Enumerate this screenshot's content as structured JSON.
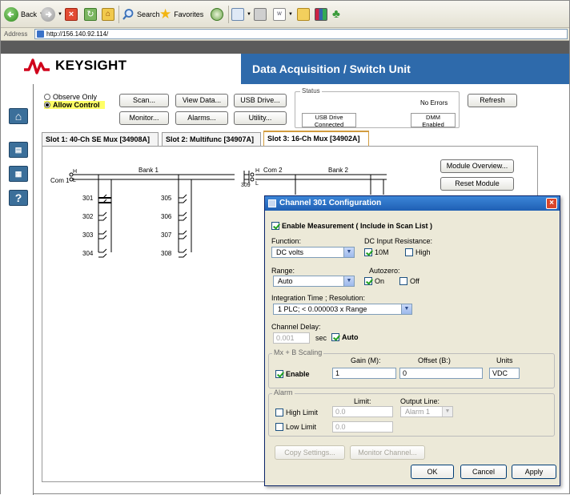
{
  "browser": {
    "toolbar": {
      "back_label": "Back",
      "search_label": "Search",
      "favorites_label": "Favorites"
    },
    "address": {
      "label": "Address",
      "url": "http://156.140.92.114/"
    }
  },
  "header": {
    "logo_text": "KEYSIGHT",
    "title": "Data Acquisition / Switch Unit"
  },
  "controls": {
    "observe_only": "Observe Only",
    "allow_control": "Allow Control",
    "buttons": {
      "scan": "Scan...",
      "monitor": "Monitor...",
      "view_data": "View Data...",
      "alarms": "Alarms...",
      "usb_drive": "USB Drive...",
      "utility": "Utility...",
      "refresh": "Refresh"
    },
    "status": {
      "legend": "Status",
      "message": "No Errors",
      "usb_line1": "USB Drive",
      "usb_line2": "Connected",
      "dmm_line1": "DMM",
      "dmm_line2": "Enabled"
    }
  },
  "tabs": [
    {
      "label": "Slot 1:  40-Ch SE Mux [34908A]"
    },
    {
      "label": "Slot 2:  Multifunc [34907A]"
    },
    {
      "label": "Slot 3:  16-Ch Mux [34902A]"
    }
  ],
  "slot_panel": {
    "com1": "Com 1",
    "bank1": "Bank 1",
    "com2": "Com 2",
    "bank2": "Bank 2",
    "h": "H",
    "l": "L",
    "ch309": "309",
    "channels_left": [
      "301",
      "302",
      "303",
      "304"
    ],
    "channels_mid": [
      "305",
      "306",
      "307",
      "308"
    ],
    "module_overview": "Module Overview...",
    "reset_module": "Reset Module"
  },
  "dialog": {
    "title": "Channel 301 Configuration",
    "enable_measurement": "Enable Measurement ( Include in Scan List )",
    "function_label": "Function:",
    "function_value": "DC volts",
    "dc_input_label": "DC Input Resistance:",
    "res_10m": "10M",
    "res_high": "High",
    "range_label": "Range:",
    "range_value": "Auto",
    "autozero_label": "Autozero:",
    "az_on": "On",
    "az_off": "Off",
    "integration_label": "Integration Time ; Resolution:",
    "integration_value": "1   PLC; < 0.000003 x Range",
    "delay_label": "Channel Delay:",
    "delay_value": "0.001",
    "delay_unit": "sec",
    "delay_auto": "Auto",
    "mxb_legend": "Mx + B Scaling",
    "gain_label": "Gain (M):",
    "offset_label": "Offset (B:)",
    "units_label": "Units",
    "scaling_enable": "Enable",
    "gain_value": "1",
    "offset_value": "0",
    "units_value": "VDC",
    "alarm_legend": "Alarm",
    "limit_label": "Limit:",
    "output_line_label": "Output Line:",
    "high_limit": "High Limit",
    "high_value": "0.0",
    "alarm_line": "Alarm 1",
    "low_limit": "Low Limit",
    "low_value": "0.0",
    "copy_settings": "Copy Settings...",
    "monitor_channel": "Monitor Channel...",
    "ok": "OK",
    "cancel": "Cancel",
    "apply": "Apply"
  },
  "colors": {
    "brand_red": "#d0021b",
    "title_band": "#2e6aab",
    "dialog_title": "#1f5fb4",
    "allow_highlight": "#ffff66"
  }
}
